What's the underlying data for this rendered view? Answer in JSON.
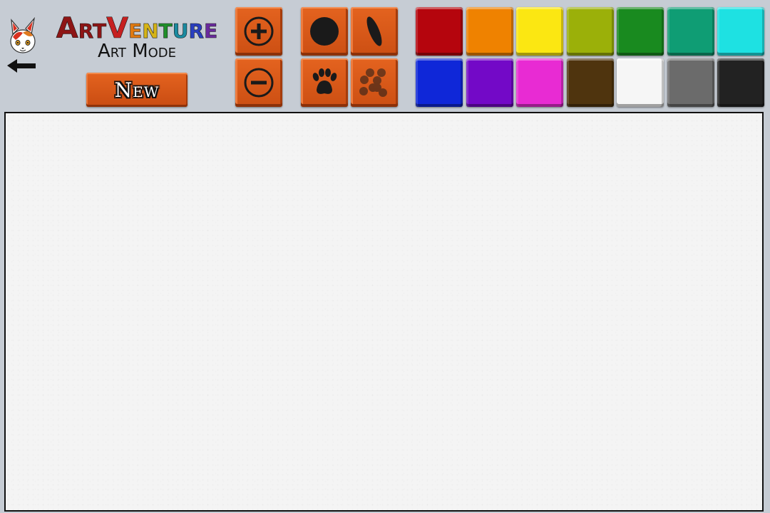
{
  "app": {
    "logo_title_parts": [
      {
        "text": "Art",
        "color": "#8e1515"
      },
      {
        "text": "V",
        "color": "#c62020"
      },
      {
        "text": "e",
        "color": "#e07a10"
      },
      {
        "text": "n",
        "color": "#d6b417"
      },
      {
        "text": "t",
        "color": "#1f8f2a"
      },
      {
        "text": "u",
        "color": "#1a8aa0"
      },
      {
        "text": "r",
        "color": "#2a3fc0"
      },
      {
        "text": "e",
        "color": "#6a2a9e"
      }
    ],
    "subtitle": "Art Mode"
  },
  "header": {
    "back_icon": "arrow-left-icon",
    "mascot_icon": "fox-mascot-icon",
    "new_label": "New"
  },
  "tools": {
    "size": [
      {
        "name": "increase-size",
        "icon": "plus-circle-icon"
      },
      {
        "name": "decrease-size",
        "icon": "minus-circle-icon"
      }
    ],
    "brushes": [
      {
        "name": "round-brush",
        "icon": "circle-brush-icon"
      },
      {
        "name": "oval-brush",
        "icon": "oval-brush-icon"
      },
      {
        "name": "paw-stamp",
        "icon": "paw-print-icon"
      },
      {
        "name": "dots-brush",
        "icon": "spots-brush-icon"
      }
    ]
  },
  "palette": {
    "colors": [
      "#b5050d",
      "#ef8200",
      "#fbe712",
      "#9bb009",
      "#198a1f",
      "#0f9d74",
      "#1ee1e2",
      "#0f27d8",
      "#7309c7",
      "#e82bd3",
      "#4f340e",
      "#f6f6f6",
      "#6b6b6b",
      "#222222"
    ]
  },
  "tool_color": "#d9581a",
  "canvas": {
    "background": "#f4f4f4"
  }
}
